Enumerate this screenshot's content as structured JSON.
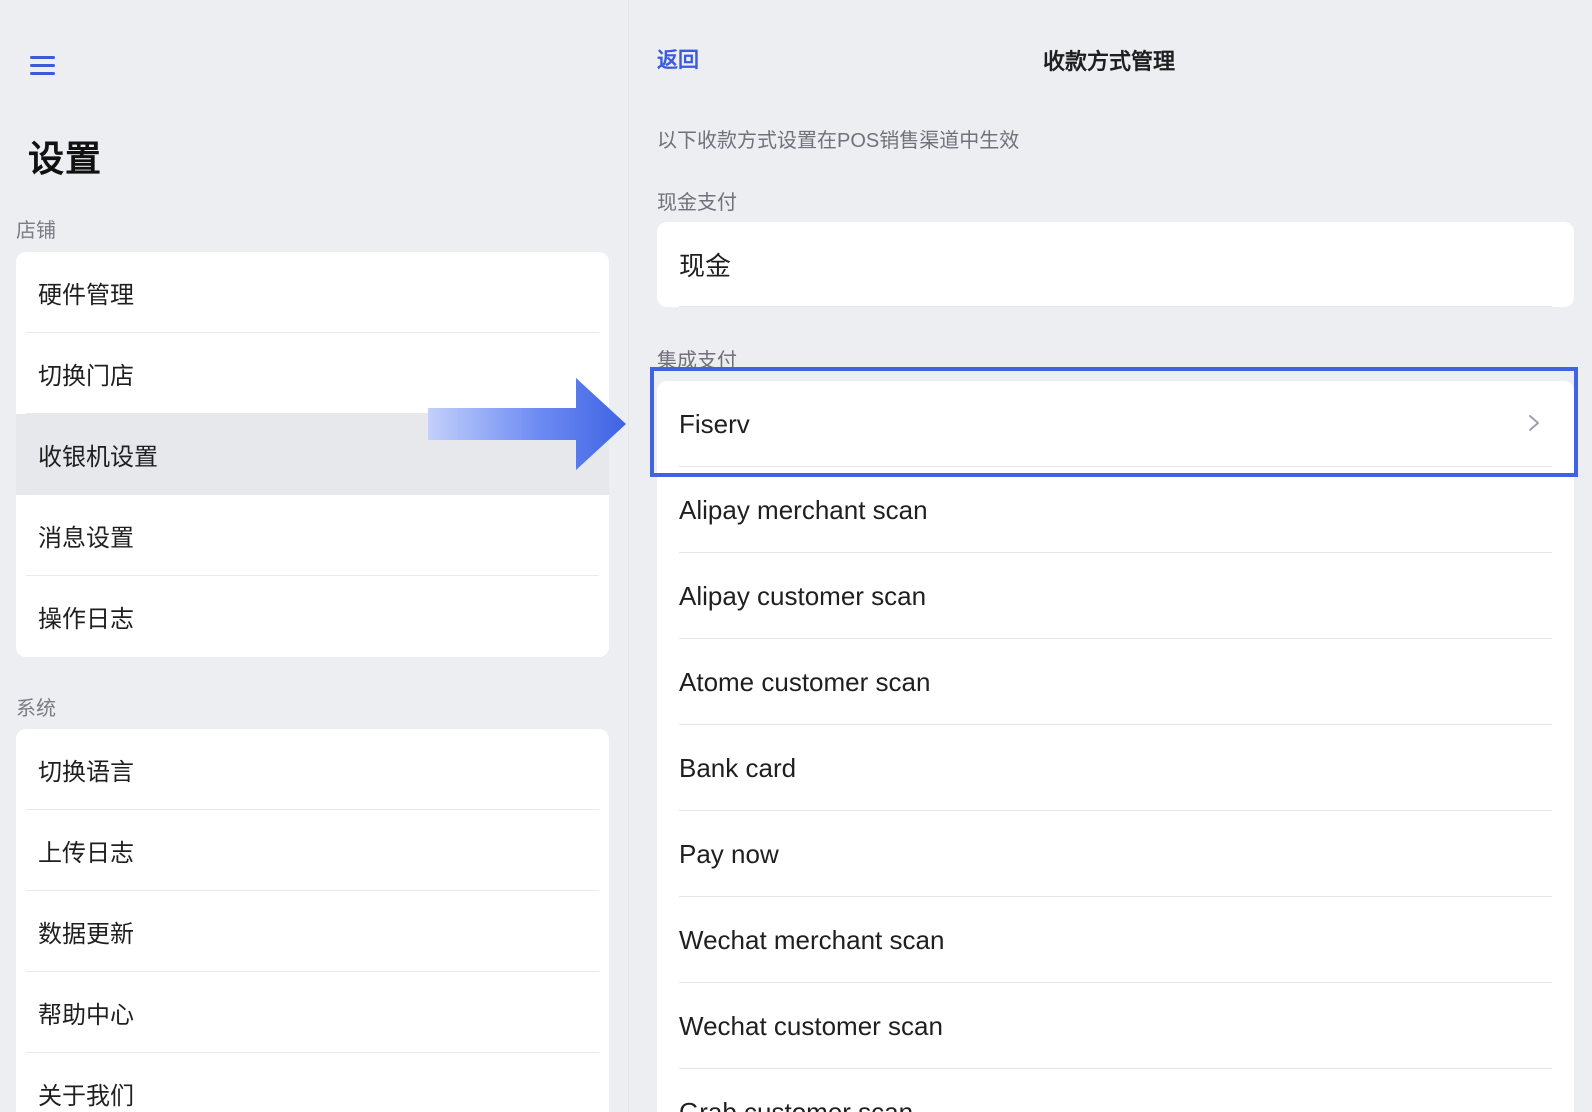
{
  "left": {
    "title": "设置",
    "store_section": "店铺",
    "store_items": [
      {
        "label": "硬件管理"
      },
      {
        "label": "切换门店"
      },
      {
        "label": "收银机设置"
      },
      {
        "label": "消息设置"
      },
      {
        "label": "操作日志"
      }
    ],
    "system_section": "系统",
    "system_items": [
      {
        "label": "切换语言"
      },
      {
        "label": "上传日志"
      },
      {
        "label": "数据更新"
      },
      {
        "label": "帮助中心"
      },
      {
        "label": "关于我们"
      }
    ]
  },
  "right": {
    "back_label": "返回",
    "title": "收款方式管理",
    "hint": "以下收款方式设置在POS销售渠道中生效",
    "cash_section": "现金支付",
    "cash_items": [
      {
        "label": "现金"
      }
    ],
    "integrated_section": "集成支付",
    "integrated_items": [
      {
        "label": "Fiserv"
      },
      {
        "label": "Alipay merchant scan"
      },
      {
        "label": "Alipay customer scan"
      },
      {
        "label": "Atome customer scan"
      },
      {
        "label": "Bank card"
      },
      {
        "label": "Pay now"
      },
      {
        "label": "Wechat merchant scan"
      },
      {
        "label": "Wechat customer scan"
      },
      {
        "label": "Grab customer scan"
      }
    ]
  },
  "colors": {
    "accent": "#3b5bdb",
    "highlight": "#3f63e3",
    "background": "#eceef2"
  }
}
